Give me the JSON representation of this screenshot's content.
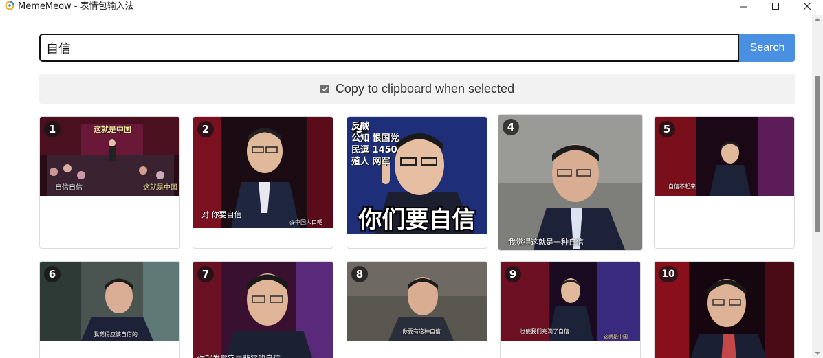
{
  "window": {
    "title": "MemeMeow - 表情包输入法"
  },
  "search": {
    "value": "自信",
    "button_label": "Search"
  },
  "options": {
    "copy_label": "Copy to clipboard when selected",
    "copy_checked": true
  },
  "results": [
    {
      "index": "1",
      "top_text": "这就是中国",
      "caption": "自信自信",
      "caption2": "这就是中国"
    },
    {
      "index": "2",
      "caption": "对 你要自信",
      "caption2": "@中国人口吧"
    },
    {
      "index": "3",
      "top_text": "反贼\n公知 恨国党\n民逗 1450\n殖人 网军",
      "big_caption": "你们要自信"
    },
    {
      "index": "4",
      "caption": "我觉得这就是一种自信"
    },
    {
      "index": "5",
      "caption": "自信不起来"
    },
    {
      "index": "6",
      "caption": "我觉得应该自信的"
    },
    {
      "index": "7",
      "caption": "你就发觉它是非常的自信"
    },
    {
      "index": "8",
      "caption": "你要有这种自信"
    },
    {
      "index": "9",
      "caption": "也使我们充满了自信",
      "caption2": "这就是中国"
    },
    {
      "index": "10"
    }
  ]
}
